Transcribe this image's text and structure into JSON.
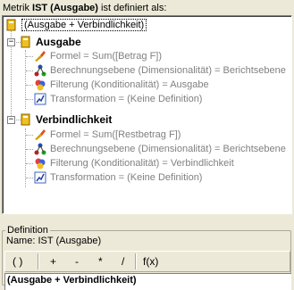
{
  "header": {
    "prefix": "Metrik",
    "metric_name": "IST (Ausgabe)",
    "suffix": "ist definiert als:"
  },
  "tree": {
    "root_label": "(Ausgabe + Verbindlichkeit)",
    "nodes": [
      {
        "label": "Ausgabe",
        "children": [
          {
            "icon": "formula-icon",
            "label": "Formel = Sum([Betrag F])"
          },
          {
            "icon": "calculation-level-icon",
            "label": "Berechnungsebene (Dimensionalität) = Berichtsebene"
          },
          {
            "icon": "filter-icon",
            "label": "Filterung (Konditionalität) = Ausgabe"
          },
          {
            "icon": "transformation-icon",
            "label": "Transformation = (Keine Definition)"
          }
        ]
      },
      {
        "label": "Verbindlichkeit",
        "children": [
          {
            "icon": "formula-icon",
            "label": "Formel = Sum([Restbetrag F])"
          },
          {
            "icon": "calculation-level-icon",
            "label": "Berechnungsebene (Dimensionalität) = Berichtsebene"
          },
          {
            "icon": "filter-icon",
            "label": "Filterung (Konditionalität) = Verbindlichkeit"
          },
          {
            "icon": "transformation-icon",
            "label": "Transformation = (Keine Definition)"
          }
        ]
      }
    ]
  },
  "definition": {
    "group_label": "Definition",
    "name_prefix": "Name:",
    "name_value": "IST (Ausgabe)",
    "toolbar": [
      "( )",
      "+",
      "-",
      "*",
      "/",
      "f(x)"
    ],
    "formula": "(Ausgabe + Verbindlichkeit)"
  },
  "colors": {
    "background": "#ece9d8",
    "book_yellow": "#f0c020",
    "child_text": "#808080"
  }
}
